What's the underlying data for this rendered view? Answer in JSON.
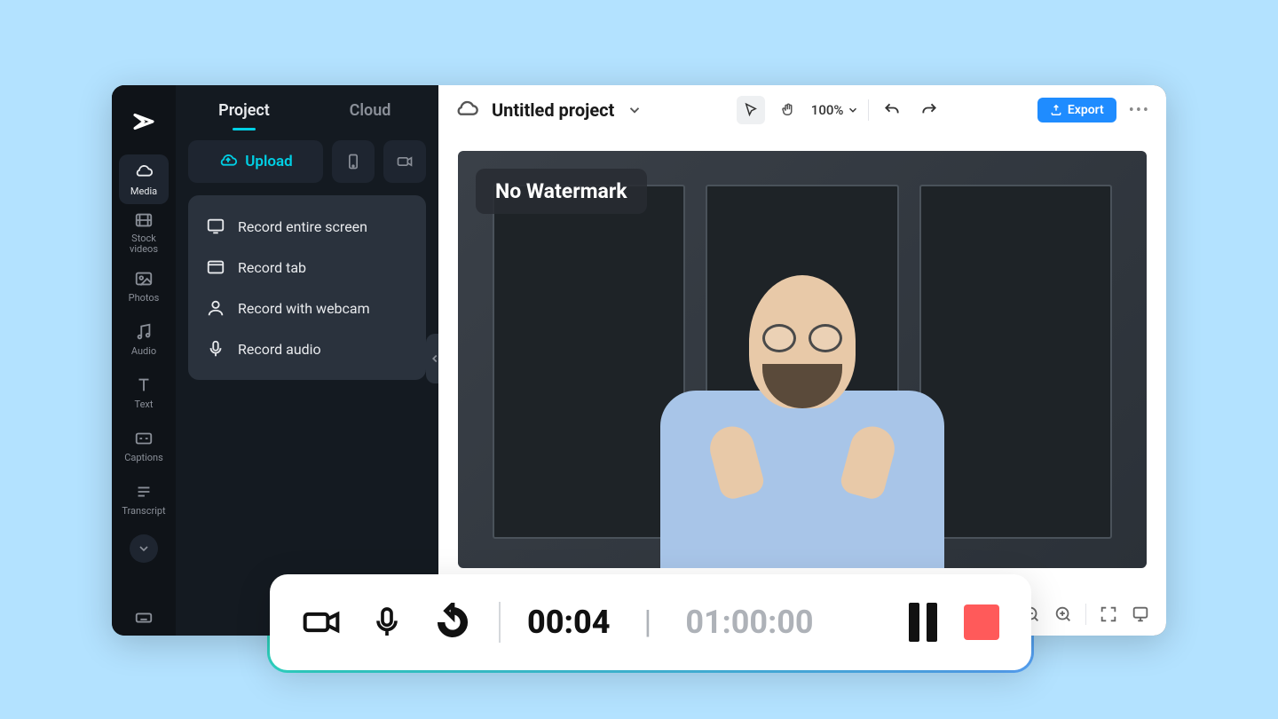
{
  "sidebar": {
    "items": [
      {
        "label": "Media"
      },
      {
        "label": "Stock\nvideos"
      },
      {
        "label": "Photos"
      },
      {
        "label": "Audio"
      },
      {
        "label": "Text"
      },
      {
        "label": "Captions"
      },
      {
        "label": "Transcript"
      }
    ]
  },
  "panel": {
    "tab_project": "Project",
    "tab_cloud": "Cloud",
    "upload_label": "Upload"
  },
  "record_menu": {
    "entire_screen": "Record entire screen",
    "tab": "Record tab",
    "webcam": "Record with webcam",
    "audio": "Record audio"
  },
  "header": {
    "project_name": "Untitled project",
    "zoom": "100%",
    "export": "Export"
  },
  "preview": {
    "watermark_badge": "No Watermark"
  },
  "recording": {
    "elapsed": "00:04",
    "total": "01:00:00"
  }
}
